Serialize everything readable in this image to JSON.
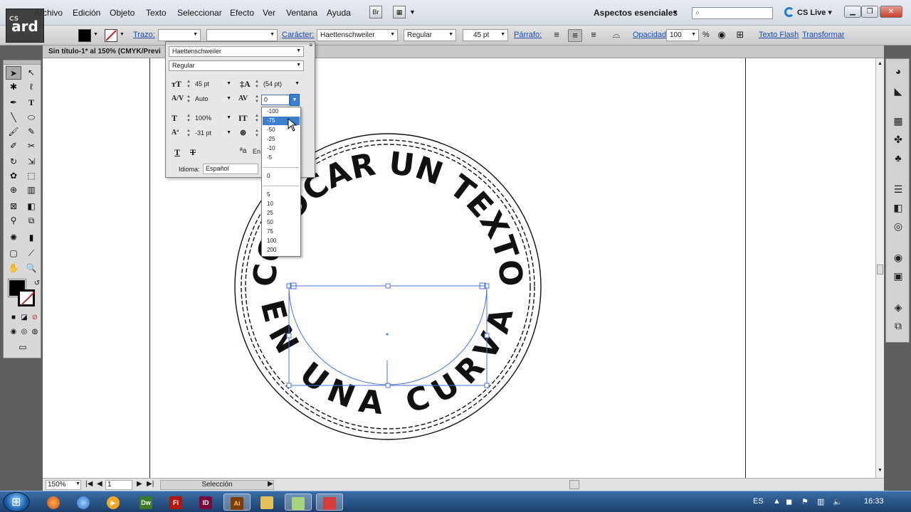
{
  "app": {
    "logo_text": "ard",
    "logo_sub": "CS",
    "menus": [
      "Archivo",
      "Edición",
      "Objeto",
      "Texto",
      "Seleccionar",
      "Efecto",
      "Ver",
      "Ventana",
      "Ayuda"
    ],
    "bridge_label": "Br",
    "workspace": "Aspectos esenciales",
    "search_placeholder": "",
    "cs_live": "CS Live"
  },
  "control_bar": {
    "stroke_label": "Trazo:",
    "character_label": "Carácter:",
    "font_family": "Haettenschweiler",
    "font_style": "Regular",
    "font_size": "45 pt",
    "paragraph_label": "Párrafo:",
    "opacity_label": "Opacidad:",
    "opacity_value": "100",
    "opacity_unit": "%",
    "flash_text": "Texto Flash",
    "transform": "Transformar"
  },
  "document": {
    "tab_title": "Sin título-1* al 150% (CMYK/Previ",
    "text_top": "COLOCAR UN TEXTO",
    "text_bottom": "EN UNA CURVA"
  },
  "character_panel": {
    "font_family": "Haettenschweiler",
    "font_style": "Regular",
    "size": "45 pt",
    "leading": "(54 pt)",
    "kerning": "Auto",
    "tracking": "0",
    "horizontal_scale": "100%",
    "baseline_shift": "-31 pt",
    "language_label": "Idioma:",
    "language": "Español",
    "aa_label": "En"
  },
  "tracking_options": {
    "group1": [
      "-100",
      "-75",
      "-50",
      "-25",
      "-10",
      "-5"
    ],
    "group2": [
      "0"
    ],
    "group3": [
      "5",
      "10",
      "25",
      "50",
      "75",
      "100",
      "200"
    ],
    "highlighted": "-75"
  },
  "status_bar": {
    "zoom": "150%",
    "page": "1",
    "tool": "Selección"
  },
  "taskbar": {
    "language": "ES",
    "clock": "16:33",
    "apps": [
      "Firefox",
      "Thunderbird",
      "Media",
      "Dw",
      "Fl",
      "ID",
      "Ai",
      "Explorer",
      "Files",
      "Paint"
    ]
  },
  "colors": {
    "accent": "#3c7fd1",
    "link": "#1f4fb3",
    "selection_path": "#4a72d6"
  }
}
